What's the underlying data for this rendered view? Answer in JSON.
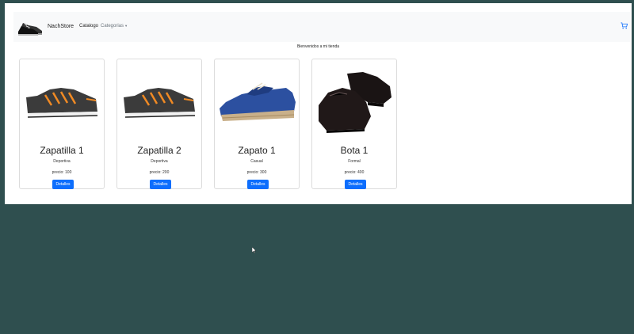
{
  "navbar": {
    "brand": "NachStore",
    "links": [
      {
        "label": "Catalogo"
      },
      {
        "label": "Categorias"
      }
    ],
    "cart_icon": "shopping-cart-icon"
  },
  "main": {
    "welcome": "Bienvenidos a mi tienda"
  },
  "products": [
    {
      "name": "Zapatilla 1",
      "category": "Deportiva",
      "price": "precio: 100",
      "button": "Detalles"
    },
    {
      "name": "Zapatilla 2",
      "category": "Deportiva",
      "price": "precio: 200",
      "button": "Detalles"
    },
    {
      "name": "Zapato 1",
      "category": "Casual",
      "price": "precio: 300",
      "button": "Detalles"
    },
    {
      "name": "Bota 1",
      "category": "Formal",
      "price": "precio: 400",
      "button": "Detalles"
    }
  ],
  "colors": {
    "background": "#2f4f4f",
    "navbar": "#f8f9fa",
    "button": "#0d6efd"
  }
}
